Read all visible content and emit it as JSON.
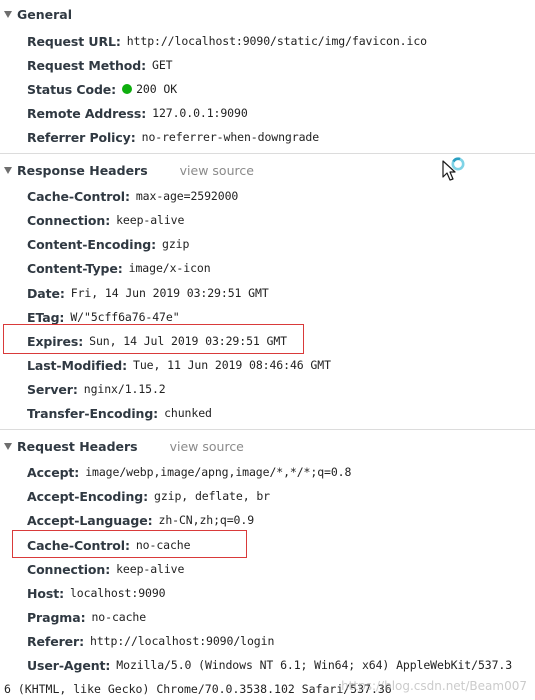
{
  "general": {
    "title": "General",
    "request_url": {
      "key": "Request URL:",
      "value": "http://localhost:9090/static/img/favicon.ico"
    },
    "request_method": {
      "key": "Request Method:",
      "value": "GET"
    },
    "status_code": {
      "key": "Status Code:",
      "value": "200 OK"
    },
    "remote_address": {
      "key": "Remote Address:",
      "value": "127.0.0.1:9090"
    },
    "referrer_policy": {
      "key": "Referrer Policy:",
      "value": "no-referrer-when-downgrade"
    }
  },
  "response_headers": {
    "title": "Response Headers",
    "view_source": "view source",
    "cache_control": {
      "key": "Cache-Control:",
      "value": "max-age=2592000"
    },
    "connection": {
      "key": "Connection:",
      "value": "keep-alive"
    },
    "content_encoding": {
      "key": "Content-Encoding:",
      "value": "gzip"
    },
    "content_type": {
      "key": "Content-Type:",
      "value": "image/x-icon"
    },
    "date": {
      "key": "Date:",
      "value": "Fri, 14 Jun 2019 03:29:51 GMT"
    },
    "etag": {
      "key": "ETag:",
      "value": "W/\"5cff6a76-47e\""
    },
    "expires": {
      "key": "Expires:",
      "value": "Sun, 14 Jul 2019 03:29:51 GMT"
    },
    "last_modified": {
      "key": "Last-Modified:",
      "value": "Tue, 11 Jun 2019 08:46:46 GMT"
    },
    "server": {
      "key": "Server:",
      "value": "nginx/1.15.2"
    },
    "transfer_encoding": {
      "key": "Transfer-Encoding:",
      "value": "chunked"
    }
  },
  "request_headers": {
    "title": "Request Headers",
    "view_source": "view source",
    "accept": {
      "key": "Accept:",
      "value": "image/webp,image/apng,image/*,*/*;q=0.8"
    },
    "accept_encoding": {
      "key": "Accept-Encoding:",
      "value": "gzip, deflate, br"
    },
    "accept_language": {
      "key": "Accept-Language:",
      "value": "zh-CN,zh;q=0.9"
    },
    "cache_control": {
      "key": "Cache-Control:",
      "value": "no-cache"
    },
    "connection": {
      "key": "Connection:",
      "value": "keep-alive"
    },
    "host": {
      "key": "Host:",
      "value": "localhost:9090"
    },
    "pragma": {
      "key": "Pragma:",
      "value": "no-cache"
    },
    "referer": {
      "key": "Referer:",
      "value": "http://localhost:9090/login"
    },
    "user_agent": {
      "key": "User-Agent:",
      "value_line1": "Mozilla/5.0 (Windows NT 6.1; Win64; x64) AppleWebKit/537.3",
      "value_line2": "6 (KHTML, like Gecko) Chrome/70.0.3538.102 Safari/537.36"
    }
  },
  "watermark": "https://blog.csdn.net/Beam007",
  "colors": {
    "status_ok": "#0eae0e",
    "highlight_box": "#d93a3a",
    "key_text": "#303942",
    "view_source": "#8a8a8a"
  },
  "icons": {
    "section_toggle": "triangle-down-icon",
    "cursor": "busy-cursor-icon"
  }
}
